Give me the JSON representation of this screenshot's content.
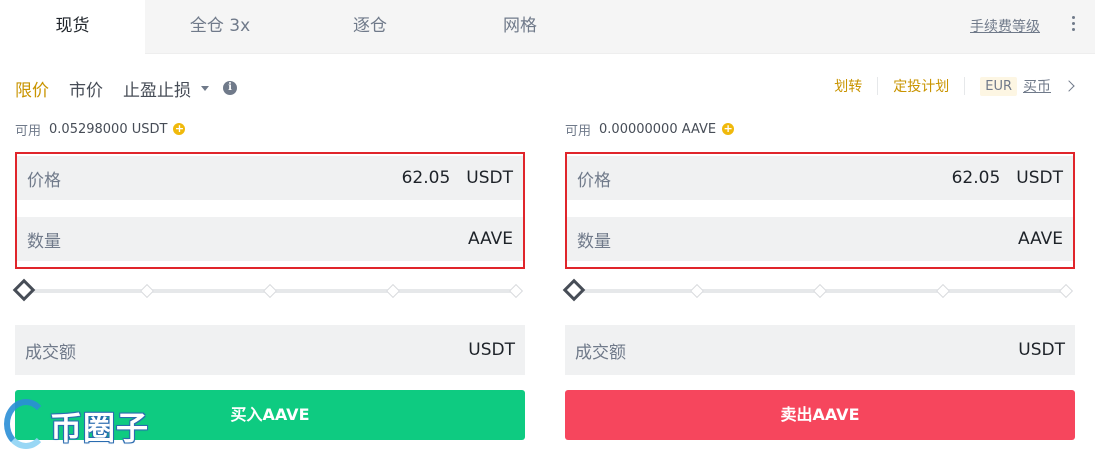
{
  "tabs": [
    {
      "label": "现货",
      "active": true
    },
    {
      "label": "全仓 3x",
      "active": false
    },
    {
      "label": "逐仓",
      "active": false
    },
    {
      "label": "网格",
      "active": false
    }
  ],
  "header": {
    "fee_link": "手续费等级",
    "more_icon": "more-vertical-icon"
  },
  "order_types": {
    "limit": "限价",
    "market": "市价",
    "stop": "止盈止损",
    "active": "限价"
  },
  "top_actions": {
    "transfer": "划转",
    "plan": "定投计划",
    "currency": "EUR",
    "buy_coin": "买币"
  },
  "buy_panel": {
    "available_label": "可用",
    "available_value": "0.05298000 USDT",
    "price_label": "价格",
    "price_value": "62.05",
    "price_unit": "USDT",
    "amount_label": "数量",
    "amount_unit": "AAVE",
    "slider_percent": 0,
    "total_label": "成交额",
    "total_unit": "USDT",
    "button_label": "买入AAVE"
  },
  "sell_panel": {
    "available_label": "可用",
    "available_value": "0.00000000 AAVE",
    "price_label": "价格",
    "price_value": "62.05",
    "price_unit": "USDT",
    "amount_label": "数量",
    "amount_unit": "AAVE",
    "slider_percent": 0,
    "total_label": "成交额",
    "total_unit": "USDT",
    "button_label": "卖出AAVE"
  },
  "colors": {
    "accent": "#c99400",
    "buy": "#0ecb81",
    "sell": "#f6465d",
    "highlight_border": "#e0252b"
  },
  "watermark": {
    "text": "币圈子"
  }
}
